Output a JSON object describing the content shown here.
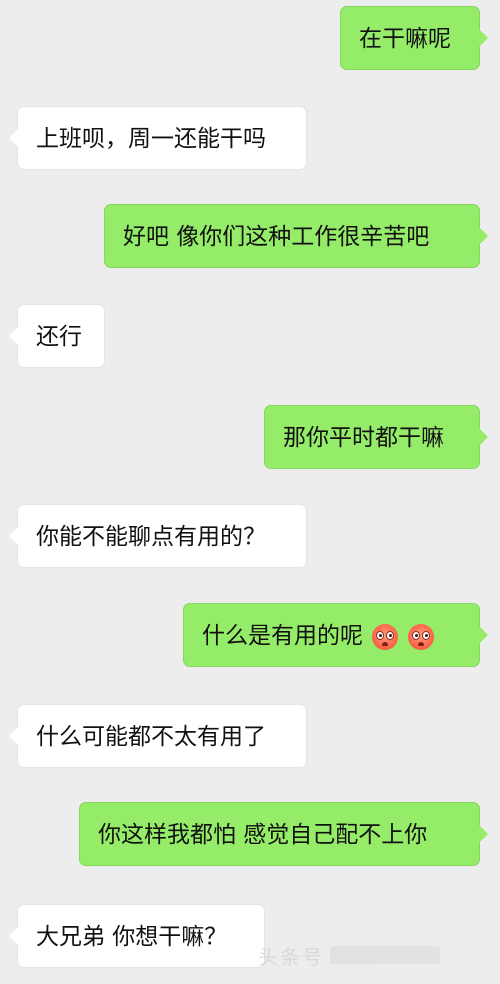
{
  "messages": [
    {
      "side": "sent",
      "text": "在干嘛呢"
    },
    {
      "side": "received",
      "text": "上班呗，周一还能干吗"
    },
    {
      "side": "sent",
      "text": "好吧 像你们这种工作很辛苦吧"
    },
    {
      "side": "received",
      "text": "还行"
    },
    {
      "side": "sent",
      "text": "那你平时都干嘛"
    },
    {
      "side": "received",
      "text": "你能不能聊点有用的？"
    },
    {
      "side": "sent",
      "text": "什么是有用的呢",
      "emojis": [
        "blushing-face-emoji",
        "blushing-face-emoji"
      ]
    },
    {
      "side": "received",
      "text": "什么可能都不太有用了"
    },
    {
      "side": "sent",
      "text": "你这样我都怕 感觉自己配不上你"
    },
    {
      "side": "received",
      "text": "大兄弟 你想干嘛？"
    }
  ],
  "watermark": {
    "text": "头条号"
  },
  "colors": {
    "background": "#ededed",
    "sent_bubble": "#95ec69",
    "received_bubble": "#ffffff",
    "text": "#111111"
  }
}
